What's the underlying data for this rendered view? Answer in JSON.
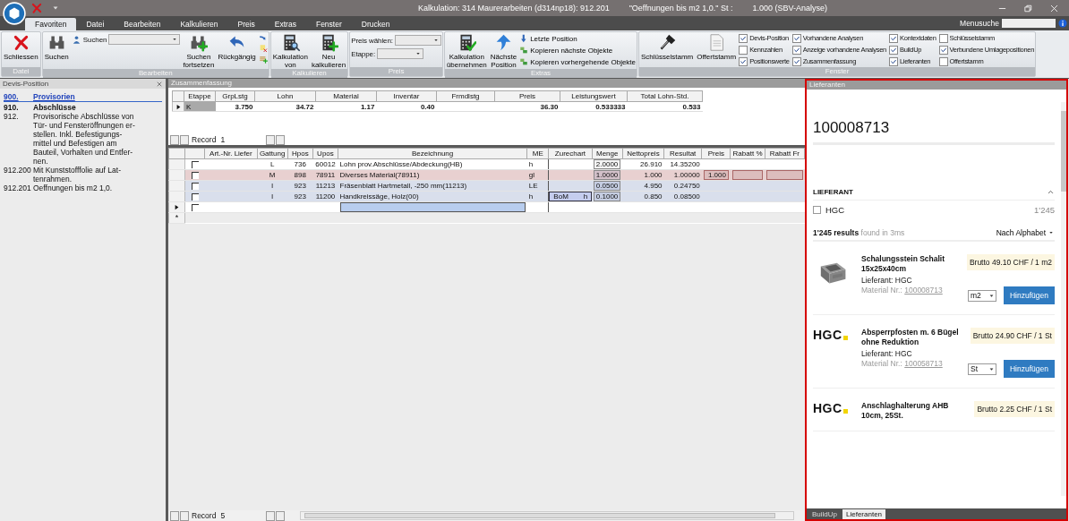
{
  "window": {
    "title": [
      "Kalkulation: 314 Maurerarbeiten (d314np18): 912.201",
      "\"Oeffnungen bis m2 1,0.\" St :",
      "1.000 (SBV-Analyse)"
    ]
  },
  "menu_tabs": [
    {
      "label": "Favoriten",
      "selected": true
    },
    {
      "label": "Datei",
      "selected": false
    },
    {
      "label": "Bearbeiten",
      "selected": false
    },
    {
      "label": "Kalkulieren",
      "selected": false
    },
    {
      "label": "Preis",
      "selected": false
    },
    {
      "label": "Extras",
      "selected": false
    },
    {
      "label": "Fenster",
      "selected": false
    },
    {
      "label": "Drucken",
      "selected": false
    }
  ],
  "menu_search": {
    "label": "Menusuche"
  },
  "ribbon": [
    {
      "label": "Datei",
      "items": [
        {
          "kind": "large",
          "label": [
            "Schliessen"
          ]
        }
      ]
    },
    {
      "label": "Bearbeiten",
      "items": [
        {
          "kind": "large",
          "label": [
            "Suchen"
          ]
        },
        {
          "kind": "field",
          "label": "Suchen"
        },
        {
          "kind": "large",
          "label": [
            "Suchen",
            "fortsetzen"
          ]
        },
        {
          "kind": "large",
          "label": [
            "Rückgängig"
          ]
        },
        {
          "kind": "icons"
        }
      ]
    },
    {
      "label": "Kalkulieren",
      "items": [
        {
          "kind": "large",
          "label": [
            "Kalkulation",
            "von"
          ]
        },
        {
          "kind": "large",
          "label": [
            "Neu",
            "kalkulieren"
          ]
        }
      ]
    },
    {
      "label": "Preis",
      "items": [
        {
          "kind": "combos",
          "fields": [
            {
              "label": "Preis wählen:"
            },
            {
              "label": "Etappe:"
            }
          ]
        }
      ]
    },
    {
      "label": "Extras",
      "items": [
        {
          "kind": "large",
          "label": [
            "Kalkulation",
            "übernehmen"
          ]
        },
        {
          "kind": "large",
          "label": [
            "Nächste",
            "Position"
          ]
        },
        {
          "kind": "links",
          "links": [
            "Letzte Position",
            "Kopieren nächste Objekte",
            "Kopieren vorhergehende Objekte"
          ]
        }
      ]
    },
    {
      "label": "Fenster",
      "items": [
        {
          "kind": "large",
          "label": [
            "Schlüsselstamm"
          ]
        },
        {
          "kind": "large",
          "label": [
            "Offertstamm"
          ]
        },
        {
          "kind": "checks",
          "columns": [
            [
              {
                "label": "Devis-Position",
                "checked": true
              },
              {
                "label": "Kennzahlen",
                "checked": false
              },
              {
                "label": "Positionswerte",
                "checked": true
              }
            ],
            [
              {
                "label": "Vorhandene Analysen",
                "checked": true
              },
              {
                "label": "Anzeige vorhandene Analysen",
                "checked": true
              },
              {
                "label": "Zusammenfassung",
                "checked": true
              }
            ],
            [
              {
                "label": "Kontextdaten",
                "checked": true
              },
              {
                "label": "BuildUp",
                "checked": true
              },
              {
                "label": "Lieferanten",
                "checked": true
              }
            ],
            [
              {
                "label": "Schlüsselstamm",
                "checked": false
              },
              {
                "label": "Verbundene Umlagepositionen",
                "checked": true
              },
              {
                "label": "Offertstamm",
                "checked": false
              }
            ]
          ]
        }
      ]
    }
  ],
  "devis_position": {
    "title": "Devis-Position",
    "items": [
      {
        "number": "900.",
        "lines": [
          "Provisorien"
        ],
        "kind": "link"
      },
      {
        "number": "910.",
        "lines": [
          "Abschlüsse"
        ],
        "kind": "bold"
      },
      {
        "number": "912.",
        "lines": [
          "Provisorische Abschlüsse von",
          "Tür- und Fensteröffnungen er-",
          "stellen. Inkl. Befestigungs-",
          "mittel und Befestigen am",
          "Bauteil, Vorhalten und Entfer-",
          "nen."
        ],
        "kind": "plain"
      },
      {
        "number": "912.200",
        "lines": [
          "Mit Kunststofffolie auf Lat-",
          "tenrahmen."
        ],
        "kind": "plain"
      },
      {
        "number": "912.201",
        "lines": [
          "Oeffnungen bis m2 1,0."
        ],
        "kind": "plain"
      }
    ]
  },
  "zusammenfassung": {
    "title": "Zusammenfassung",
    "columns": [
      "Etappe",
      "GrpLstg",
      "Lohn",
      "Material",
      "Inventar",
      "Frmdlstg",
      "Preis",
      "Leistungswert",
      "Total Lohn-Std."
    ],
    "row": {
      "etappe": "K",
      "grplstg": "3.750",
      "lohn": "34.72",
      "material": "1.17",
      "inventar": "0.40",
      "preis": "36.30",
      "leistungswert": "0.533333",
      "total_lohn_std": "0.533"
    },
    "record": {
      "label": "Record",
      "value": "1"
    }
  },
  "positions": {
    "columns": [
      "Art.-Nr. Liefer",
      "Gattung",
      "Hpos",
      "Upos",
      "Bezeichnung",
      "ME",
      "Zurechart",
      "Menge",
      "Nettopreis",
      "Resultat",
      "Preis",
      "Rabatt %",
      "Rabatt Fr"
    ],
    "rows": [
      {
        "color": "#ffffff",
        "checked": false,
        "gattung": "L",
        "hpos": "736",
        "upos": "60012",
        "bezeichnung": "Lohn prov.Abschlüsse/Abdeckung(HB)",
        "me": "h",
        "menge": "2.0000",
        "nettopreis": "26.910",
        "resultat": "14.35200"
      },
      {
        "color": "#e8d0d0",
        "checked": false,
        "gattung": "M",
        "hpos": "898",
        "upos": "78911",
        "bezeichnung": "Diverses Material(78911)",
        "me": "gl",
        "menge": "1.0000",
        "nettopreis": "1.000",
        "resultat": "1.00000",
        "preis": "1.000"
      },
      {
        "color": "#d9dfec",
        "checked": false,
        "gattung": "I",
        "hpos": "923",
        "upos": "11213",
        "bezeichnung": "Fräsenblatt Hartmetall, -250 mm(11213)",
        "me": "LE",
        "menge": "0.0500",
        "nettopreis": "4.950",
        "resultat": "0.24750"
      },
      {
        "color": "#d9dfec",
        "checked": false,
        "gattung": "I",
        "hpos": "923",
        "upos": "11200",
        "bezeichnung": "Handkreissäge, Holz(00)",
        "me": "h",
        "zurechart": [
          "BoM",
          "h"
        ],
        "menge": "0.1000",
        "nettopreis": "0.850",
        "resultat": "0.08500"
      }
    ],
    "new_row": {
      "checked": false,
      "current": true
    },
    "append_marker": "*",
    "record": {
      "label": "Record",
      "value": "5"
    }
  },
  "lieferanten": {
    "title": "Lieferanten",
    "search": {
      "value": "100008713"
    },
    "facet": {
      "title": "LIEFERANT",
      "expanded": true,
      "options": [
        {
          "label": "HGC",
          "checked": false,
          "count": "1'245"
        }
      ]
    },
    "results": {
      "count": "1'245 results",
      "time": "found in 3ms",
      "sort": "Nach Alphabet"
    },
    "products": [
      {
        "kind": "picture",
        "name": "Schalungsstein Schalit 15x25x40cm",
        "supplier": "Lieferant: HGC",
        "material_label": "Material Nr.:",
        "material_no": "100008713",
        "price": "Brutto 49.10 CHF / 1 m2",
        "unit": "m2",
        "button": "Hinzufügen"
      },
      {
        "kind": "logo",
        "logo": "HGC",
        "name": "Absperrpfosten m. 6 Bügel ohne Reduktion",
        "supplier": "Lieferant: HGC",
        "material_label": "Material Nr.:",
        "material_no": "100058713",
        "price": "Brutto 24.90 CHF / 1 St",
        "unit": "St",
        "button": "Hinzufügen"
      },
      {
        "kind": "logo",
        "logo": "HGC",
        "name": "Anschlaghalterung AHB 10cm, 25St.",
        "price": "Brutto 2.25 CHF / 1 St"
      }
    ],
    "tabs": [
      {
        "label": "BuildUp",
        "selected": false
      },
      {
        "label": "Lieferanten",
        "selected": true
      }
    ]
  }
}
